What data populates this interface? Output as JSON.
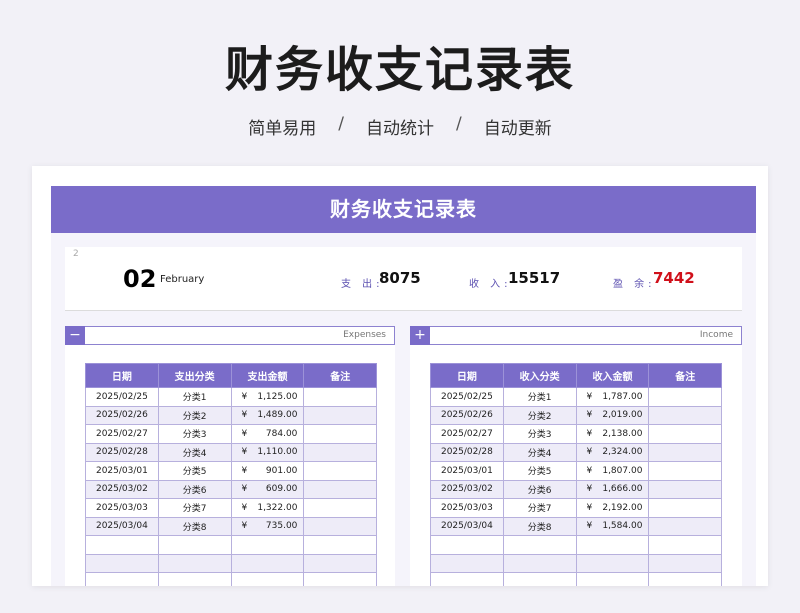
{
  "header": {
    "title": "财务收支记录表",
    "features": [
      "简单易用",
      "自动统计",
      "自动更新"
    ],
    "separator": "/"
  },
  "sheet": {
    "banner_title": "财务收支记录表",
    "row_number": "2",
    "summary": {
      "month_number": "02",
      "month_name": "February",
      "expense_label": "支 出:",
      "expense_value": "8075",
      "income_label": "收 入:",
      "income_value": "15517",
      "surplus_label": "盈 余:",
      "surplus_value": "7442"
    },
    "expense_panel": {
      "toggle": "−",
      "title": "Expenses",
      "headers": [
        "日期",
        "支出分类",
        "支出金额",
        "备注"
      ],
      "rows": [
        {
          "date": "2025/02/25",
          "category": "分类1",
          "amount": "1,125.00"
        },
        {
          "date": "2025/02/26",
          "category": "分类2",
          "amount": "1,489.00"
        },
        {
          "date": "2025/02/27",
          "category": "分类3",
          "amount": "784.00"
        },
        {
          "date": "2025/02/28",
          "category": "分类4",
          "amount": "1,110.00"
        },
        {
          "date": "2025/03/01",
          "category": "分类5",
          "amount": "901.00"
        },
        {
          "date": "2025/03/02",
          "category": "分类6",
          "amount": "609.00"
        },
        {
          "date": "2025/03/03",
          "category": "分类7",
          "amount": "1,322.00"
        },
        {
          "date": "2025/03/04",
          "category": "分类8",
          "amount": "735.00"
        }
      ]
    },
    "income_panel": {
      "toggle": "+",
      "title": "Income",
      "headers": [
        "日期",
        "收入分类",
        "收入金额",
        "备注"
      ],
      "rows": [
        {
          "date": "2025/02/25",
          "category": "分类1",
          "amount": "1,787.00"
        },
        {
          "date": "2025/02/26",
          "category": "分类2",
          "amount": "2,019.00"
        },
        {
          "date": "2025/02/27",
          "category": "分类3",
          "amount": "2,138.00"
        },
        {
          "date": "2025/02/28",
          "category": "分类4",
          "amount": "2,324.00"
        },
        {
          "date": "2025/03/01",
          "category": "分类5",
          "amount": "1,807.00"
        },
        {
          "date": "2025/03/02",
          "category": "分类6",
          "amount": "1,666.00"
        },
        {
          "date": "2025/03/03",
          "category": "分类7",
          "amount": "2,192.00"
        },
        {
          "date": "2025/03/04",
          "category": "分类8",
          "amount": "1,584.00"
        }
      ]
    },
    "currency_symbol": "¥",
    "empty_rows": 3
  },
  "colors": {
    "accent": "#7a6cc9",
    "surplus": "#d0101a",
    "row_alt": "#eeecf8"
  }
}
